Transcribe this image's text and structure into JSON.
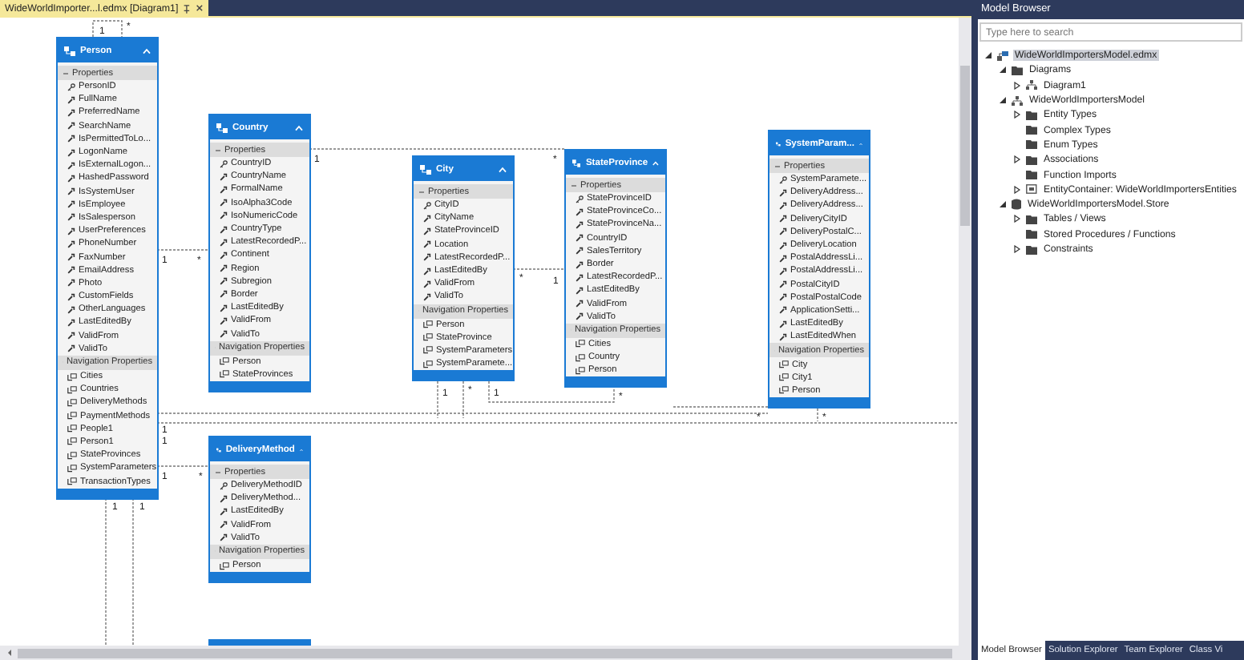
{
  "document_tab": {
    "title": "WideWorldImporter...l.edmx [Diagram1]"
  },
  "entities": [
    {
      "name": "Person",
      "properties_label": "Properties",
      "navigation_label": "Navigation Properties",
      "properties": [
        {
          "name": "PersonID",
          "key": true
        },
        {
          "name": "FullName",
          "key": false
        },
        {
          "name": "PreferredName",
          "key": false
        },
        {
          "name": "SearchName",
          "key": false
        },
        {
          "name": "IsPermittedToLo...",
          "key": false
        },
        {
          "name": "LogonName",
          "key": false
        },
        {
          "name": "IsExternalLogon...",
          "key": false
        },
        {
          "name": "HashedPassword",
          "key": false
        },
        {
          "name": "IsSystemUser",
          "key": false
        },
        {
          "name": "IsEmployee",
          "key": false
        },
        {
          "name": "IsSalesperson",
          "key": false
        },
        {
          "name": "UserPreferences",
          "key": false
        },
        {
          "name": "PhoneNumber",
          "key": false
        },
        {
          "name": "FaxNumber",
          "key": false
        },
        {
          "name": "EmailAddress",
          "key": false
        },
        {
          "name": "Photo",
          "key": false
        },
        {
          "name": "CustomFields",
          "key": false
        },
        {
          "name": "OtherLanguages",
          "key": false
        },
        {
          "name": "LastEditedBy",
          "key": false
        },
        {
          "name": "ValidFrom",
          "key": false
        },
        {
          "name": "ValidTo",
          "key": false
        }
      ],
      "navigation": [
        "Cities",
        "Countries",
        "DeliveryMethods",
        "PaymentMethods",
        "People1",
        "Person1",
        "StateProvinces",
        "SystemParameters",
        "TransactionTypes"
      ]
    },
    {
      "name": "Country",
      "properties_label": "Properties",
      "navigation_label": "Navigation Properties",
      "properties": [
        {
          "name": "CountryID",
          "key": true
        },
        {
          "name": "CountryName",
          "key": false
        },
        {
          "name": "FormalName",
          "key": false
        },
        {
          "name": "IsoAlpha3Code",
          "key": false
        },
        {
          "name": "IsoNumericCode",
          "key": false
        },
        {
          "name": "CountryType",
          "key": false
        },
        {
          "name": "LatestRecordedP...",
          "key": false
        },
        {
          "name": "Continent",
          "key": false
        },
        {
          "name": "Region",
          "key": false
        },
        {
          "name": "Subregion",
          "key": false
        },
        {
          "name": "Border",
          "key": false
        },
        {
          "name": "LastEditedBy",
          "key": false
        },
        {
          "name": "ValidFrom",
          "key": false
        },
        {
          "name": "ValidTo",
          "key": false
        }
      ],
      "navigation": [
        "Person",
        "StateProvinces"
      ]
    },
    {
      "name": "City",
      "properties_label": "Properties",
      "navigation_label": "Navigation Properties",
      "properties": [
        {
          "name": "CityID",
          "key": true
        },
        {
          "name": "CityName",
          "key": false
        },
        {
          "name": "StateProvinceID",
          "key": false
        },
        {
          "name": "Location",
          "key": false
        },
        {
          "name": "LatestRecordedP...",
          "key": false
        },
        {
          "name": "LastEditedBy",
          "key": false
        },
        {
          "name": "ValidFrom",
          "key": false
        },
        {
          "name": "ValidTo",
          "key": false
        }
      ],
      "navigation": [
        "Person",
        "StateProvince",
        "SystemParameters",
        "SystemParamete..."
      ]
    },
    {
      "name": "StateProvince",
      "properties_label": "Properties",
      "navigation_label": "Navigation Properties",
      "properties": [
        {
          "name": "StateProvinceID",
          "key": true
        },
        {
          "name": "StateProvinceCo...",
          "key": false
        },
        {
          "name": "StateProvinceNa...",
          "key": false
        },
        {
          "name": "CountryID",
          "key": false
        },
        {
          "name": "SalesTerritory",
          "key": false
        },
        {
          "name": "Border",
          "key": false
        },
        {
          "name": "LatestRecordedP...",
          "key": false
        },
        {
          "name": "LastEditedBy",
          "key": false
        },
        {
          "name": "ValidFrom",
          "key": false
        },
        {
          "name": "ValidTo",
          "key": false
        }
      ],
      "navigation": [
        "Cities",
        "Country",
        "Person"
      ]
    },
    {
      "name": "SystemParam...",
      "properties_label": "Properties",
      "navigation_label": "Navigation Properties",
      "properties": [
        {
          "name": "SystemParamete...",
          "key": true
        },
        {
          "name": "DeliveryAddress...",
          "key": false
        },
        {
          "name": "DeliveryAddress...",
          "key": false
        },
        {
          "name": "DeliveryCityID",
          "key": false
        },
        {
          "name": "DeliveryPostalC...",
          "key": false
        },
        {
          "name": "DeliveryLocation",
          "key": false
        },
        {
          "name": "PostalAddressLi...",
          "key": false
        },
        {
          "name": "PostalAddressLi...",
          "key": false
        },
        {
          "name": "PostalCityID",
          "key": false
        },
        {
          "name": "PostalPostalCode",
          "key": false
        },
        {
          "name": "ApplicationSetti...",
          "key": false
        },
        {
          "name": "LastEditedBy",
          "key": false
        },
        {
          "name": "LastEditedWhen",
          "key": false
        }
      ],
      "navigation": [
        "City",
        "City1",
        "Person"
      ]
    },
    {
      "name": "DeliveryMethod",
      "properties_label": "Properties",
      "navigation_label": "Navigation Properties",
      "properties": [
        {
          "name": "DeliveryMethodID",
          "key": true
        },
        {
          "name": "DeliveryMethod...",
          "key": false
        },
        {
          "name": "LastEditedBy",
          "key": false
        },
        {
          "name": "ValidFrom",
          "key": false
        },
        {
          "name": "ValidTo",
          "key": false
        }
      ],
      "navigation": [
        "Person"
      ]
    }
  ],
  "connectors": [
    {
      "labels": [
        "1",
        "*"
      ]
    },
    {
      "labels": [
        "1",
        "*"
      ]
    },
    {
      "labels": [
        "1",
        "1"
      ]
    },
    {
      "labels": [
        "1",
        "*"
      ]
    },
    {
      "labels": [
        "1",
        "1"
      ]
    },
    {
      "labels": [
        "1",
        "*"
      ]
    },
    {
      "labels": [
        "*",
        "1"
      ]
    },
    {
      "labels": [
        "1",
        "*",
        "1",
        "*"
      ]
    },
    {
      "labels": [
        "*"
      ]
    },
    {
      "labels": [
        "*"
      ]
    }
  ],
  "model_browser": {
    "title": "Model Browser",
    "search": {
      "placeholder": "Type here to search"
    },
    "tree": [
      {
        "label": "WideWorldImportersModel.edmx",
        "kind": "edmx",
        "expanded": true,
        "selected": true,
        "children": [
          {
            "label": "Diagrams",
            "kind": "folder",
            "expanded": true,
            "selected": false,
            "children": [
              {
                "label": "Diagram1",
                "kind": "diagram",
                "expanded": false,
                "selected": false
              }
            ]
          },
          {
            "label": "WideWorldImportersModel",
            "kind": "model",
            "expanded": true,
            "selected": false,
            "children": [
              {
                "label": "Entity Types",
                "kind": "folder",
                "expanded": false,
                "selected": false
              },
              {
                "label": "Complex Types",
                "kind": "folder",
                "selected": false
              },
              {
                "label": "Enum Types",
                "kind": "folder",
                "selected": false
              },
              {
                "label": "Associations",
                "kind": "folder",
                "expanded": false,
                "selected": false
              },
              {
                "label": "Function Imports",
                "kind": "folder",
                "selected": false
              },
              {
                "label": "EntityContainer: WideWorldImportersEntities",
                "kind": "container",
                "expanded": false,
                "selected": false
              }
            ]
          },
          {
            "label": "WideWorldImportersModel.Store",
            "kind": "database",
            "expanded": true,
            "selected": false,
            "children": [
              {
                "label": "Tables / Views",
                "kind": "folder",
                "expanded": false,
                "selected": false
              },
              {
                "label": "Stored Procedures / Functions",
                "kind": "folder",
                "selected": false
              },
              {
                "label": "Constraints",
                "kind": "folder",
                "expanded": false,
                "selected": false
              }
            ]
          }
        ]
      }
    ]
  },
  "bottom_tabs": [
    {
      "label": "Model Browser",
      "selected": true
    },
    {
      "label": "Solution Explorer",
      "selected": false
    },
    {
      "label": "Team Explorer",
      "selected": false
    },
    {
      "label": "Class Vi",
      "selected": false
    }
  ]
}
